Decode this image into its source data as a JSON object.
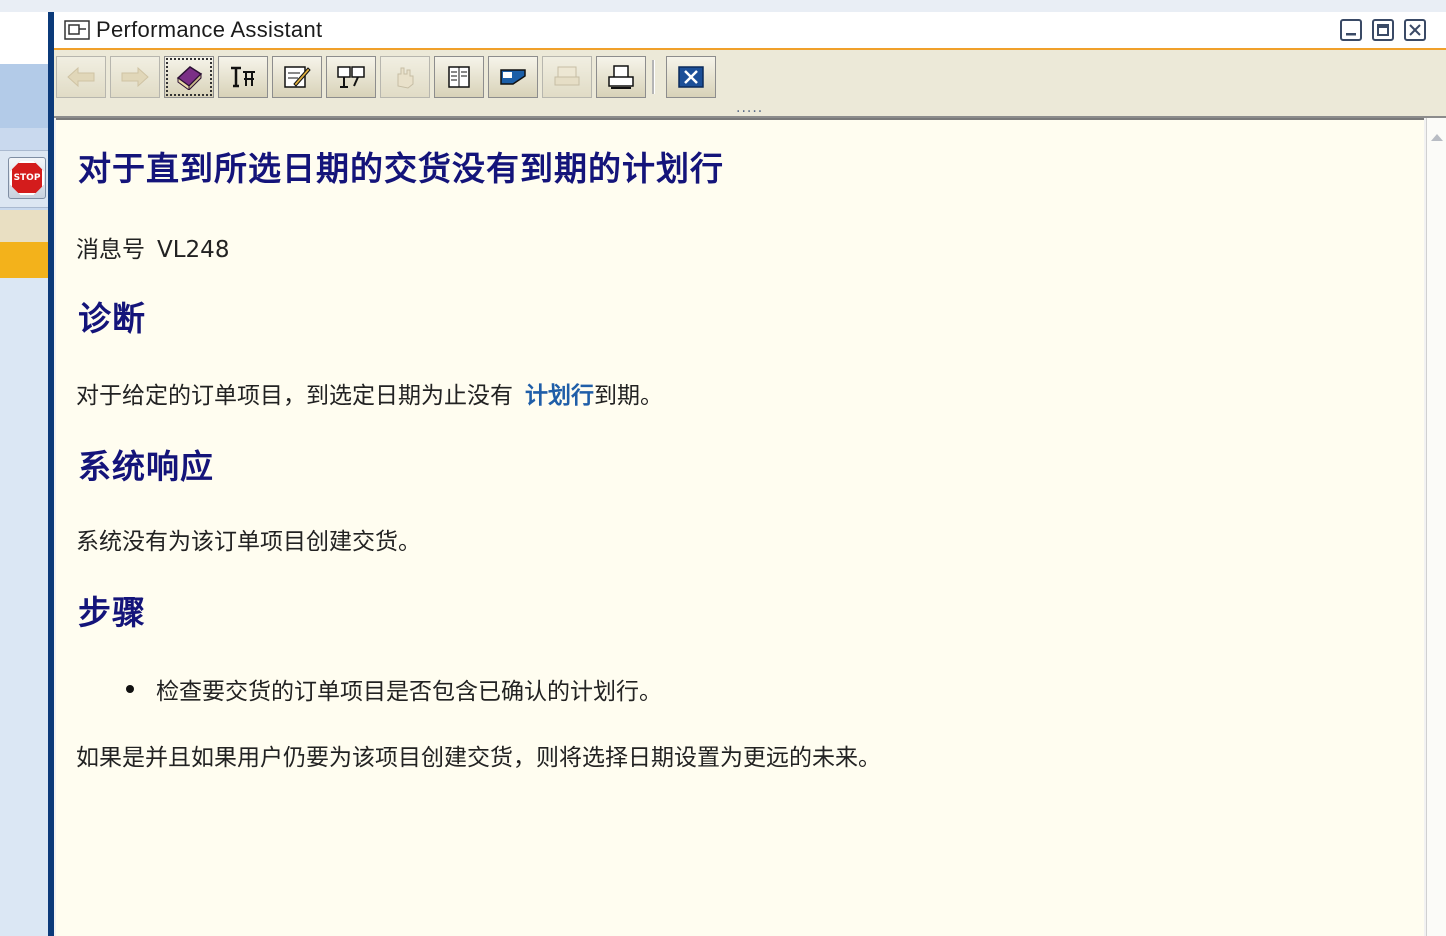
{
  "window": {
    "title": "Performance Assistant"
  },
  "toolbar": {
    "buttons": [
      {
        "icon": "back-arrow-icon",
        "enabled": false
      },
      {
        "icon": "forward-arrow-icon",
        "enabled": false
      },
      {
        "icon": "book-icon",
        "enabled": true
      },
      {
        "icon": "technical-info-icon",
        "enabled": true
      },
      {
        "icon": "edit-note-icon",
        "enabled": true
      },
      {
        "icon": "glossary-icon",
        "enabled": true
      },
      {
        "icon": "hand-icon",
        "enabled": false
      },
      {
        "icon": "document-list-icon",
        "enabled": true
      },
      {
        "icon": "display-icon",
        "enabled": true
      },
      {
        "icon": "print-preview-icon",
        "enabled": false
      },
      {
        "icon": "printer-icon",
        "enabled": true
      },
      {
        "icon": "close-icon",
        "enabled": true
      }
    ]
  },
  "content": {
    "title": "对于直到所选日期的交货没有到期的计划行",
    "message_label": "消息号",
    "message_number": "VL248",
    "diagnosis_heading": "诊断",
    "diagnosis_text_before": "对于给定的订单项目，到选定日期为止没有",
    "diagnosis_link": "计划行",
    "diagnosis_text_after": "到期。",
    "response_heading": "系统响应",
    "response_text": "系统没有为该订单项目创建交货。",
    "procedure_heading": "步骤",
    "procedure_bullet": "检查要交货的订单项目是否包含已确认的计划行。",
    "procedure_text": "如果是并且如果用户仍要为该项目创建交货，则将选择日期设置为更远的未来。"
  },
  "background": {
    "stop_label": "STOP"
  },
  "colors": {
    "heading": "#14147a",
    "link": "#1f5ea8",
    "content_bg": "#fffdf0",
    "title_accent": "#f0a02a"
  }
}
